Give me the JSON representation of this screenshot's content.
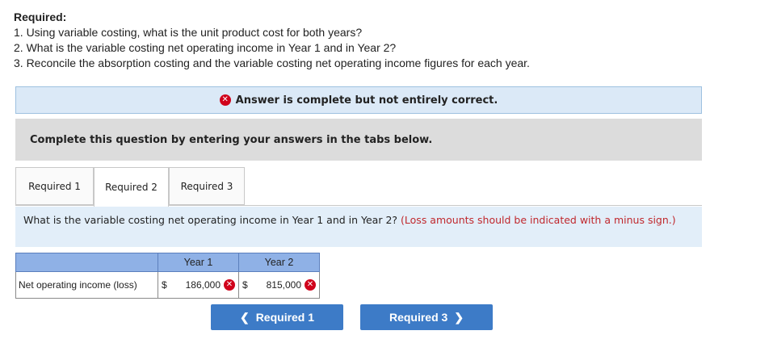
{
  "instructions": {
    "heading": "Required:",
    "items": [
      "1. Using variable costing, what is the unit product cost for both years?",
      "2. What is the variable costing net operating income in Year 1 and in Year 2?",
      "3. Reconcile the absorption costing and the variable costing net operating income figures for each year."
    ]
  },
  "banner": {
    "text": "Answer is complete but not entirely correct.",
    "icon": "x-circle-icon",
    "color": "#d0021b"
  },
  "complete_prompt": "Complete this question by entering your answers in the tabs below.",
  "tabs": [
    {
      "label": "Required 1",
      "active": false
    },
    {
      "label": "Required 2",
      "active": true
    },
    {
      "label": "Required 3",
      "active": false
    }
  ],
  "question": {
    "text": "What is the variable costing net operating income in Year 1 and in Year 2?",
    "note": "(Loss amounts should be indicated with a minus sign.)"
  },
  "table": {
    "headers": [
      "",
      "Year 1",
      "Year 2"
    ],
    "row": {
      "label": "Net operating income (loss)",
      "currency": "$",
      "year1": "186,000",
      "year2": "815,000",
      "year1_status": "incorrect",
      "year2_status": "incorrect"
    }
  },
  "nav": {
    "prev_label": "Required 1",
    "next_label": "Required 3"
  }
}
